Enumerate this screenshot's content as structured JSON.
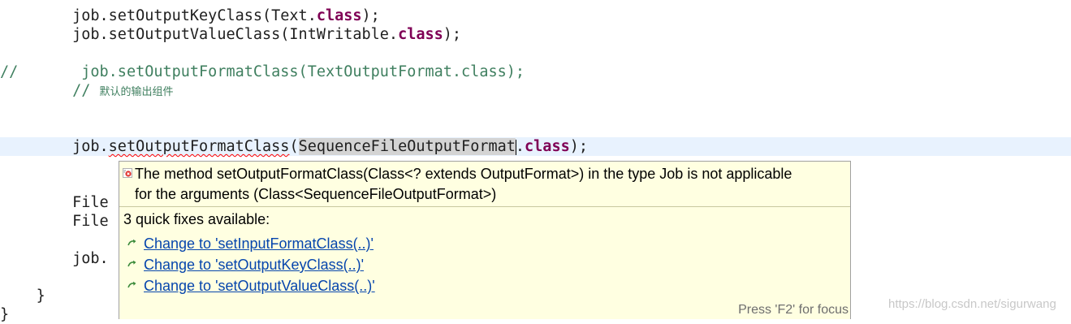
{
  "code": {
    "line1_prefix": "job.setOutputKeyClass(Text.",
    "line1_kw": "class",
    "line1_suffix": ");",
    "line2_prefix": "job.setOutputValueClass(IntWritable.",
    "line2_kw": "class",
    "line2_suffix": ");",
    "line3_comment_marker": "//",
    "line3_comment_code": "job.setOutputFormatClass(TextOutputFormat.class);",
    "line4_comment_marker": "//",
    "line4_comment_text": "默认的输出组件",
    "line5_obj": "job.",
    "line5_method": "setOutputFormatClass",
    "line5_paren": "(",
    "line5_token": "SequenceFileOutputFormat",
    "line5_dot": ".",
    "line5_kw": "class",
    "line5_suffix": ");",
    "line6_partial": "File",
    "line7_partial": "File",
    "line8_partial": "job.",
    "line9_brace": "}",
    "line10_brace": "}"
  },
  "popup": {
    "message_line1": "The method setOutputFormatClass(Class<? extends OutputFormat>) in the type Job is not applicable",
    "message_line2": "for the arguments (Class<SequenceFileOutputFormat>)",
    "quick_fix_count": "3 quick fixes available:",
    "fixes": [
      {
        "label": "Change to 'setInputFormatClass(..)'"
      },
      {
        "label": "Change to 'setOutputKeyClass(..)'"
      },
      {
        "label": "Change to 'setOutputValueClass(..)'"
      }
    ],
    "focus_hint": "Press 'F2' for focus"
  },
  "watermark": "https://blog.csdn.net/sigurwang",
  "colors": {
    "keyword": "#7f0055",
    "comment": "#3f7f5f",
    "popup_bg": "#ffffe1",
    "link": "#0645ad",
    "current_line": "#e8f2fe"
  }
}
